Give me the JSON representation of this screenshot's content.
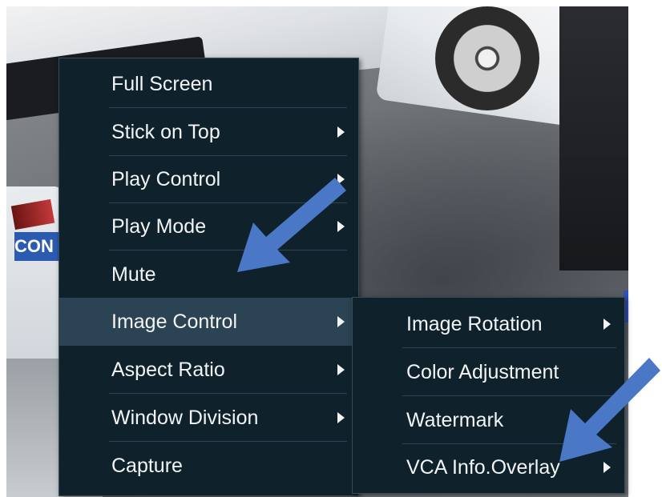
{
  "context_menu": {
    "items": [
      {
        "label": "Full Screen",
        "has_submenu": false
      },
      {
        "label": "Stick on Top",
        "has_submenu": true
      },
      {
        "label": "Play Control",
        "has_submenu": true
      },
      {
        "label": "Play Mode",
        "has_submenu": true
      },
      {
        "label": "Mute",
        "has_submenu": false
      },
      {
        "label": "Image Control",
        "has_submenu": true,
        "active": true
      },
      {
        "label": "Aspect Ratio",
        "has_submenu": true
      },
      {
        "label": "Window Division",
        "has_submenu": true
      },
      {
        "label": "Capture",
        "has_submenu": false
      }
    ]
  },
  "image_control_submenu": {
    "items": [
      {
        "label": "Image Rotation",
        "has_submenu": true
      },
      {
        "label": "Color Adjustment",
        "has_submenu": false
      },
      {
        "label": "Watermark",
        "has_submenu": false
      },
      {
        "label": "VCA Info.Overlay",
        "has_submenu": true
      }
    ]
  },
  "background": {
    "logo_text": "CON"
  },
  "colors": {
    "menu_bg": "#0f222b",
    "menu_active": "#2b4352",
    "menu_text": "#f2f4f5",
    "annotation_arrow": "#4a78c6"
  },
  "icons": {
    "submenu": "chevron-right-icon",
    "annotation": "pointer-arrow-icon"
  }
}
